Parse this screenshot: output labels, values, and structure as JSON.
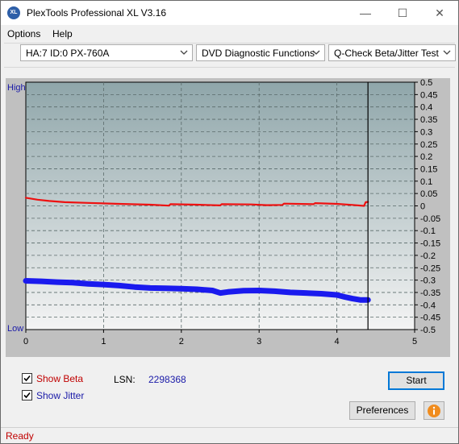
{
  "window": {
    "title": "PlexTools Professional XL V3.16",
    "icon_label": "XL",
    "minimize": "—",
    "maximize": "☐",
    "close": "✕"
  },
  "menu": {
    "options_label": "Options",
    "help_label": "Help"
  },
  "toolbar": {
    "drive_value": "HA:7 ID:0  PX-760A",
    "function_value": "DVD Diagnostic Functions",
    "test_value": "Q-Check Beta/Jitter Test"
  },
  "chart_labels": {
    "high": "High",
    "low": "Low"
  },
  "chart_data": {
    "type": "line",
    "x_ticks": [
      "0",
      "1",
      "2",
      "3",
      "4",
      "5"
    ],
    "xlim": [
      0,
      5
    ],
    "right_y_ticks": [
      "0.5",
      "0.45",
      "0.4",
      "0.35",
      "0.3",
      "0.25",
      "0.2",
      "0.15",
      "0.1",
      "0.05",
      "0",
      "-0.05",
      "-0.1",
      "-0.15",
      "-0.2",
      "-0.25",
      "-0.3",
      "-0.35",
      "-0.4",
      "-0.45",
      "-0.5"
    ],
    "ylim": [
      -0.5,
      0.5
    ],
    "grid": true,
    "end_marker_x": 4.4,
    "colors": {
      "beta": "#ee1111",
      "jitter": "#1a1aee",
      "plot_top": "#8fa6aa",
      "plot_bottom": "#f4f4f4",
      "grid": "#5a6a6a"
    },
    "series": [
      {
        "name": "Beta",
        "x": [
          0.0,
          0.15,
          0.3,
          0.5,
          0.8,
          1.2,
          1.6,
          1.84,
          1.86,
          2.2,
          2.5,
          2.52,
          2.9,
          3.1,
          3.3,
          3.32,
          3.7,
          3.72,
          4.0,
          4.2,
          4.35,
          4.37,
          4.4
        ],
        "y": [
          0.033,
          0.025,
          0.02,
          0.015,
          0.012,
          0.008,
          0.005,
          0.001,
          0.007,
          0.005,
          0.002,
          0.007,
          0.006,
          0.003,
          0.004,
          0.009,
          0.007,
          0.011,
          0.008,
          0.004,
          0.0,
          0.015,
          0.016
        ]
      },
      {
        "name": "Jitter",
        "x": [
          0.0,
          0.2,
          0.4,
          0.6,
          0.8,
          1.0,
          1.2,
          1.4,
          1.6,
          1.8,
          2.0,
          2.2,
          2.4,
          2.5,
          2.6,
          2.8,
          3.0,
          3.2,
          3.4,
          3.6,
          3.8,
          4.0,
          4.1,
          4.2,
          4.3,
          4.4
        ],
        "y": [
          -0.303,
          -0.305,
          -0.308,
          -0.31,
          -0.315,
          -0.318,
          -0.322,
          -0.328,
          -0.332,
          -0.333,
          -0.335,
          -0.337,
          -0.342,
          -0.352,
          -0.348,
          -0.343,
          -0.342,
          -0.345,
          -0.35,
          -0.352,
          -0.355,
          -0.36,
          -0.368,
          -0.375,
          -0.38,
          -0.38
        ]
      }
    ]
  },
  "controls": {
    "show_beta_label": "Show Beta",
    "show_jitter_label": "Show Jitter",
    "lsn_label": "LSN:",
    "lsn_value": "2298368",
    "start_label": "Start",
    "preferences_label": "Preferences",
    "beta_color": "#c00000",
    "jitter_color": "#1a1aa8"
  },
  "status": {
    "text": "Ready"
  }
}
